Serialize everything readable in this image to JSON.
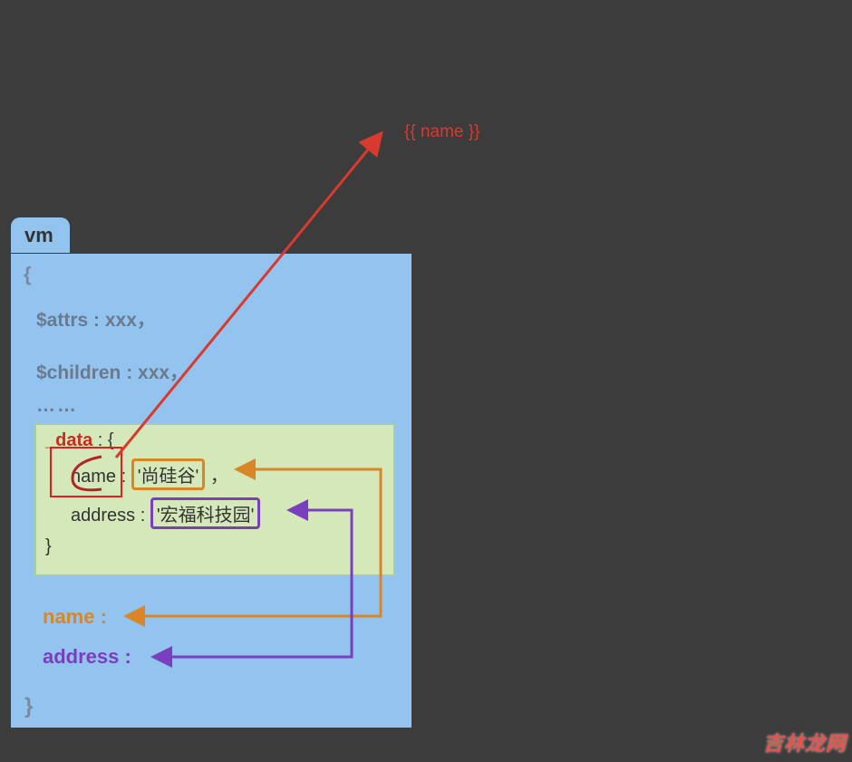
{
  "template_expr": "{{ name }}",
  "vm": {
    "tab_label": "vm",
    "open_brace": "{",
    "attrs_line": "$attrs : xxx，",
    "children_line": "$children : xxx，",
    "ellipsis": "……",
    "data_key": "_data",
    "data_colon_open": " : {",
    "name_key": "name :",
    "name_value": "'尚硅谷'",
    "name_comma": " ，",
    "address_key": "address :",
    "address_value": "'宏福科技园'",
    "data_close": "}",
    "prop_name": "name :",
    "prop_address": "address :",
    "close_brace": "}"
  },
  "watermark": "吉林龙网",
  "colors": {
    "bg": "#3c3c3c",
    "box_blue": "#93c4ef",
    "inner_green": "#d5e8b9",
    "red": "#d83a2e",
    "orange": "#d98628",
    "purple": "#7a3fbf"
  }
}
